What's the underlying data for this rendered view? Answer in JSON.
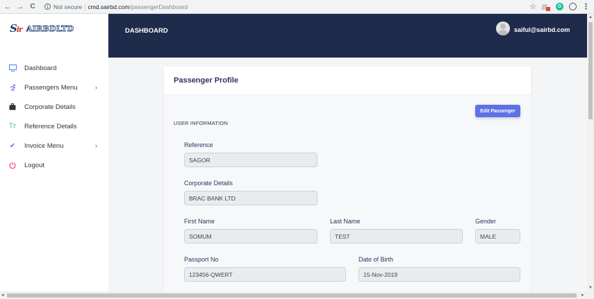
{
  "browser": {
    "back": "←",
    "forward": "→",
    "reload": "C",
    "not_secure": "Not secure",
    "url_domain": "cmd.sairbd.com",
    "url_path": "/passengerDashboard",
    "star": "☆",
    "g_badge": "G",
    "kebab": "⋮"
  },
  "logo": {
    "mark_s": "S",
    "mark_rest": "ir",
    "text": "AIRBDLTD"
  },
  "sidebar": {
    "items": [
      {
        "label": "Dashboard",
        "icon": "monitor-icon",
        "glyph": "▭",
        "color": "#3b82f6",
        "has_chevron": false
      },
      {
        "label": "Passengers Menu",
        "icon": "running-person-icon",
        "glyph": "⚲",
        "color": "#8b5cf6",
        "has_chevron": true
      },
      {
        "label": "Corporate Details",
        "icon": "briefcase-icon",
        "glyph": "▣",
        "color": "#333333",
        "has_chevron": false
      },
      {
        "label": "Reference Details",
        "icon": "text-icon",
        "glyph": "Tr",
        "color": "#2dce89",
        "has_chevron": false
      },
      {
        "label": "Invoice Menu",
        "icon": "check-icon",
        "glyph": "✔",
        "color": "#5e72e4",
        "has_chevron": true
      },
      {
        "label": "Logout",
        "icon": "power-icon",
        "glyph": "⏻",
        "color": "#f5365c",
        "has_chevron": false
      }
    ],
    "chevron": "›"
  },
  "header": {
    "title": "DASHBOARD",
    "user_email": "saiful@sairbd.com"
  },
  "card": {
    "title": "Passenger Profile",
    "edit_button": "Edit Passenger",
    "section": "USER INFORMATION",
    "fields": {
      "reference": {
        "label": "Reference",
        "value": "SAGOR"
      },
      "corporate": {
        "label": "Corporate Details",
        "value": "BRAC BANK LTD"
      },
      "first_name": {
        "label": "First Name",
        "value": "SOMUM"
      },
      "last_name": {
        "label": "Last Name",
        "value": "TEST"
      },
      "gender": {
        "label": "Gender",
        "value": "MALE"
      },
      "passport": {
        "label": "Passport No",
        "value": "123456-QWERT"
      },
      "dob": {
        "label": "Date of Birth",
        "value": "15-Nov-2019"
      }
    }
  },
  "colors": {
    "header_bg": "#1e2b4a",
    "accent": "#5e72e4"
  }
}
